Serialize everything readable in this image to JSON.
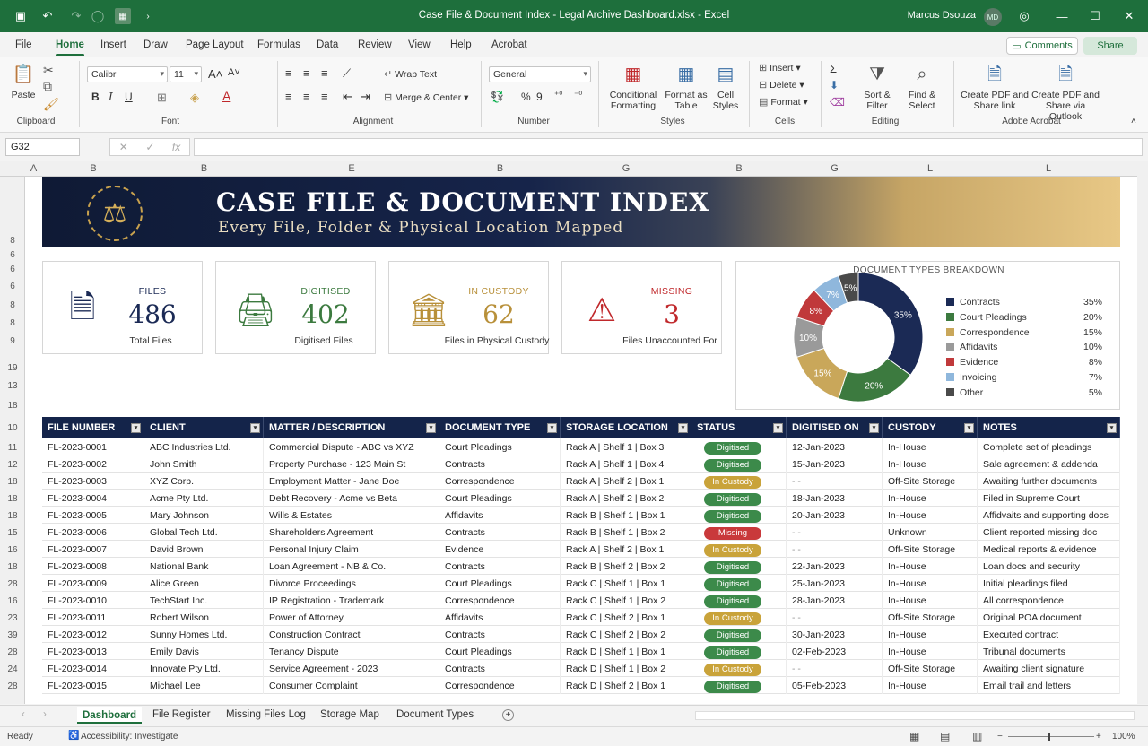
{
  "titlebar": {
    "title": "Case File & Document Index - Legal Archive Dashboard.xlsx - Excel",
    "user": "Marcus Dsouza",
    "avatar_initials": "MD",
    "icons": [
      "save-icon",
      "undo-icon",
      "redo-icon",
      "autosave-icon",
      "more-icon",
      "copilot-icon",
      "minimize-icon",
      "maximize-icon",
      "close-icon"
    ]
  },
  "ribbon_tabs": [
    "File",
    "Home",
    "Insert",
    "Draw",
    "Page Layout",
    "Formulas",
    "Data",
    "Review",
    "View",
    "Help",
    "Acrobat"
  ],
  "ribbon_actions": {
    "comments": "Comments",
    "share": "Share"
  },
  "ribbon": {
    "clipboard": {
      "paste": "Paste",
      "label": "Clipboard"
    },
    "font": {
      "name": "Calibri",
      "size": "11",
      "label": "Font"
    },
    "alignment": {
      "wrap": "Wrap Text",
      "merge": "Merge & Center",
      "label": "Alignment"
    },
    "number": {
      "format": "General",
      "label": "Number"
    },
    "styles": {
      "conditional": "Conditional Formatting",
      "format_table": "Format as Table",
      "cell_styles": "Cell Styles",
      "label": "Styles"
    },
    "cells": {
      "insert": "Insert",
      "delete": "Delete",
      "format": "Format",
      "label": "Cells"
    },
    "editing": {
      "sort": "Sort & Filter",
      "find": "Find & Select",
      "label": "Editing"
    },
    "acrobat": {
      "create_pdf": "Create PDF and Share link",
      "create_pdf_outlook": "Create PDF and Share via Outlook",
      "label": "Adobe Acrobat"
    }
  },
  "formula_bar": {
    "name_box": "G32",
    "fx": "fx",
    "value": ""
  },
  "columns": [
    "A",
    "B",
    "B",
    "E",
    "B",
    "G",
    "B",
    "G",
    "L",
    "L"
  ],
  "row_numbers": [
    "8",
    "6",
    "6",
    "6",
    "8",
    "8",
    "9",
    "19",
    "13",
    "18",
    "10",
    "11",
    "12",
    "18",
    "18",
    "18",
    "15",
    "16",
    "18",
    "28",
    "16",
    "23",
    "39",
    "28",
    "24",
    "28"
  ],
  "banner": {
    "title": "CASE FILE & DOCUMENT INDEX",
    "subtitle": "Every File, Folder & Physical Location Mapped"
  },
  "kpis": [
    {
      "label": "FILES",
      "value": "486",
      "desc": "Total Files",
      "color": "#1b2a55",
      "icon": "document-icon"
    },
    {
      "label": "DIGITISED",
      "value": "402",
      "desc": "Digitised Files",
      "color": "#3c7a3f",
      "icon": "scanner-icon"
    },
    {
      "label": "IN CUSTODY",
      "value": "62",
      "desc": "Files in Physical Custody",
      "color": "#b8903a",
      "icon": "courthouse-icon"
    },
    {
      "label": "MISSING",
      "value": "3",
      "desc": "Files Unaccounted For",
      "color": "#c0282b",
      "icon": "warning-icon"
    }
  ],
  "chart_data": {
    "type": "pie",
    "title": "DOCUMENT TYPES BREAKDOWN",
    "donut": true,
    "categories": [
      "Contracts",
      "Court Pleadings",
      "Correspondence",
      "Affidavits",
      "Evidence",
      "Invoicing",
      "Other"
    ],
    "values": [
      35,
      20,
      15,
      10,
      8,
      7,
      5
    ],
    "labels": [
      "35%",
      "20%",
      "15%",
      "10%",
      "8%",
      "7%",
      "5%"
    ],
    "colors": [
      "#1b2a55",
      "#3c7a3f",
      "#c9a75a",
      "#9a9a9a",
      "#c0393b",
      "#8fb7dc",
      "#4a4a4a"
    ],
    "legend": "right"
  },
  "table": {
    "headers": [
      "FILE NUMBER",
      "CLIENT",
      "MATTER / DESCRIPTION",
      "DOCUMENT TYPE",
      "STORAGE LOCATION",
      "STATUS",
      "DIGITISED ON",
      "CUSTODY",
      "NOTES"
    ],
    "rows": [
      [
        "FL-2023-0001",
        "ABC Industries Ltd.",
        "Commercial Dispute - ABC vs XYZ",
        "Court Pleadings",
        "Rack A | Shelf 1 | Box 3",
        "Digitised",
        "12-Jan-2023",
        "In-House",
        "Complete set of pleadings"
      ],
      [
        "FL-2023-0002",
        "John Smith",
        "Property Purchase - 123 Main St",
        "Contracts",
        "Rack A | Shelf 1 | Box 4",
        "Digitised",
        "15-Jan-2023",
        "In-House",
        "Sale agreement & addenda"
      ],
      [
        "FL-2023-0003",
        "XYZ Corp.",
        "Employment Matter - Jane Doe",
        "Correspondence",
        "Rack A | Shelf 2 | Box 1",
        "In Custody",
        "-       -",
        "Off-Site Storage",
        "Awaiting further documents"
      ],
      [
        "FL-2023-0004",
        "Acme Pty Ltd.",
        "Debt Recovery - Acme vs Beta",
        "Court Pleadings",
        "Rack A | Shelf 2 | Box 2",
        "Digitised",
        "18-Jan-2023",
        "In-House",
        "Filed in Supreme Court"
      ],
      [
        "FL-2023-0005",
        "Mary Johnson",
        "Wills & Estates",
        "Affidavits",
        "Rack B | Shelf 1 | Box 1",
        "Digitised",
        "20-Jan-2023",
        "In-House",
        "Affidvaits and supporting docs"
      ],
      [
        "FL-2023-0006",
        "Global Tech Ltd.",
        "Shareholders Agreement",
        "Contracts",
        "Rack B | Shelf 1 | Box 2",
        "Missing",
        "-       -",
        "Unknown",
        "Client reported missing doc"
      ],
      [
        "FL-2023-0007",
        "David Brown",
        "Personal Injury Claim",
        "Evidence",
        "Rack A | Shelf 2 | Box 1",
        "In Custody",
        "-       -",
        "Off-Site Storage",
        "Medical reports & evidence"
      ],
      [
        "FL-2023-0008",
        "National Bank",
        "Loan Agreement - NB & Co.",
        "Contracts",
        "Rack B | Shelf 2 | Box 2",
        "Digitised",
        "22-Jan-2023",
        "In-House",
        "Loan docs and security"
      ],
      [
        "FL-2023-0009",
        "Alice Green",
        "Divorce Proceedings",
        "Court Pleadings",
        "Rack C | Shelf 1 | Box 1",
        "Digitised",
        "25-Jan-2023",
        "In-House",
        "Initial pleadings filed"
      ],
      [
        "FL-2023-0010",
        "TechStart Inc.",
        "IP Registration - Trademark",
        "Correspondence",
        "Rack C | Shelf 1 | Box 2",
        "Digitised",
        "28-Jan-2023",
        "In-House",
        "All correspondence"
      ],
      [
        "FL-2023-0011",
        "Robert Wilson",
        "Power of Attorney",
        "Affidavits",
        "Rack C | Shelf 2 | Box 1",
        "In Custody",
        "-       -",
        "Off-Site Storage",
        "Original POA document"
      ],
      [
        "FL-2023-0012",
        "Sunny Homes Ltd.",
        "Construction Contract",
        "Contracts",
        "Rack C | Shelf 2 | Box 2",
        "Digitised",
        "30-Jan-2023",
        "In-House",
        "Executed contract"
      ],
      [
        "FL-2023-0013",
        "Emily Davis",
        "Tenancy Dispute",
        "Court Pleadings",
        "Rack D | Shelf 1 | Box 1",
        "Digitised",
        "02-Feb-2023",
        "In-House",
        "Tribunal documents"
      ],
      [
        "FL-2023-0014",
        "Innovate Pty Ltd.",
        "Service Agreement - 2023",
        "Contracts",
        "Rack D | Shelf 1 | Box 2",
        "In Custody",
        "-       -",
        "Off-Site Storage",
        "Awaiting client signature"
      ],
      [
        "FL-2023-0015",
        "Michael Lee",
        "Consumer Complaint",
        "Correspondence",
        "Rack D | Shelf 2 | Box 1",
        "Digitised",
        "05-Feb-2023",
        "In-House",
        "Email trail and letters"
      ]
    ],
    "status_colors": {
      "Digitised": "#3c8a4a",
      "In Custody": "#c9a33a",
      "Missing": "#c9393b"
    }
  },
  "sheet_tabs": [
    "Dashboard",
    "File Register",
    "Missing Files Log",
    "Storage Map",
    "Document Types"
  ],
  "status_bar": {
    "ready": "Ready",
    "accessibility": "Accessibility: Investigate",
    "zoom": "100%"
  }
}
